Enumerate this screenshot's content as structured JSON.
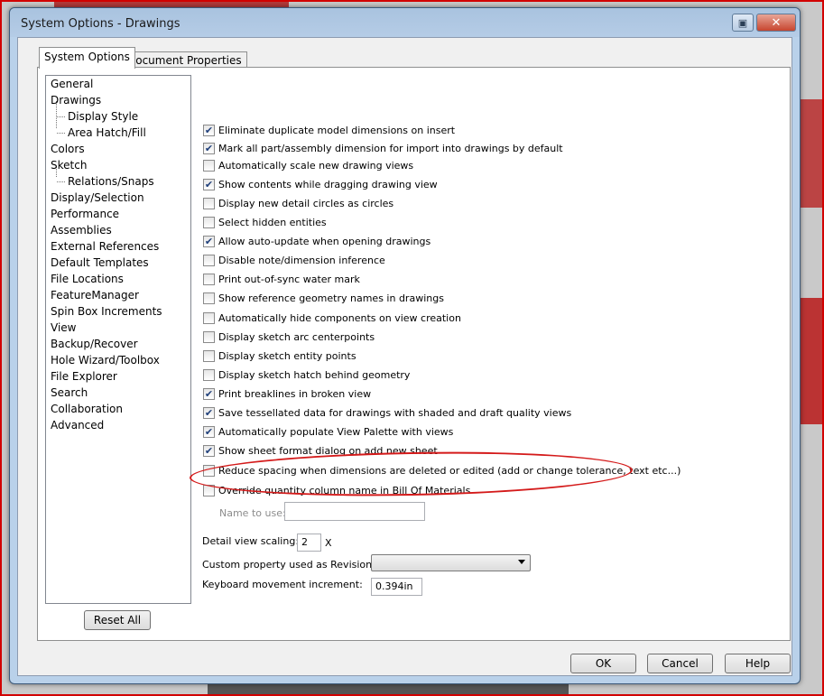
{
  "window": {
    "title": "System Options - Drawings"
  },
  "tabs": [
    {
      "label": "System Options",
      "active": true
    },
    {
      "label": "Document Properties",
      "active": false
    }
  ],
  "tree": [
    {
      "label": "General",
      "level": 0
    },
    {
      "label": "Drawings",
      "level": 0
    },
    {
      "label": "Display Style",
      "level": 1
    },
    {
      "label": "Area Hatch/Fill",
      "level": 1
    },
    {
      "label": "Colors",
      "level": 0
    },
    {
      "label": "Sketch",
      "level": 0
    },
    {
      "label": "Relations/Snaps",
      "level": 1
    },
    {
      "label": "Display/Selection",
      "level": 0
    },
    {
      "label": "Performance",
      "level": 0
    },
    {
      "label": "Assemblies",
      "level": 0
    },
    {
      "label": "External References",
      "level": 0
    },
    {
      "label": "Default Templates",
      "level": 0
    },
    {
      "label": "File Locations",
      "level": 0
    },
    {
      "label": "FeatureManager",
      "level": 0
    },
    {
      "label": "Spin Box Increments",
      "level": 0
    },
    {
      "label": "View",
      "level": 0
    },
    {
      "label": "Backup/Recover",
      "level": 0
    },
    {
      "label": "Hole Wizard/Toolbox",
      "level": 0
    },
    {
      "label": "File Explorer",
      "level": 0
    },
    {
      "label": "Search",
      "level": 0
    },
    {
      "label": "Collaboration",
      "level": 0
    },
    {
      "label": "Advanced",
      "level": 0
    }
  ],
  "reset_all_label": "Reset All",
  "options": [
    {
      "label": "Eliminate duplicate model dimensions on insert",
      "checked": true
    },
    {
      "label": "Mark all part/assembly dimension for import into drawings by default",
      "checked": true
    },
    {
      "label": "Automatically scale new drawing views",
      "checked": false
    },
    {
      "label": "Show contents while dragging drawing view",
      "checked": true
    },
    {
      "label": "Display new detail circles as circles",
      "checked": false
    },
    {
      "label": "Select hidden entities",
      "checked": false
    },
    {
      "label": "Allow auto-update when opening drawings",
      "checked": true
    },
    {
      "label": "Disable note/dimension inference",
      "checked": false
    },
    {
      "label": "Print out-of-sync water mark",
      "checked": false
    },
    {
      "label": "Show reference geometry names in drawings",
      "checked": false
    },
    {
      "label": "Automatically hide components on view creation",
      "checked": false
    },
    {
      "label": "Display sketch arc centerpoints",
      "checked": false
    },
    {
      "label": "Display sketch entity points",
      "checked": false
    },
    {
      "label": "Display sketch hatch behind geometry",
      "checked": false
    },
    {
      "label": "Print breaklines in broken view",
      "checked": true
    },
    {
      "label": "Save tessellated data for drawings with shaded and draft quality views",
      "checked": true
    },
    {
      "label": "Automatically populate View Palette with views",
      "checked": true
    },
    {
      "label": "Show sheet format dialog on add new sheet",
      "checked": true
    },
    {
      "label": "Reduce spacing when dimensions are deleted or edited (add or change tolerance, text etc...)",
      "checked": false
    },
    {
      "label": "Override quantity column name in Bill Of Materials",
      "checked": false
    }
  ],
  "name_to_use": {
    "label": "Name to use:",
    "value": ""
  },
  "detail_view_scaling": {
    "label": "Detail view scaling:",
    "value": "2",
    "suffix": "X"
  },
  "custom_property_revision": {
    "label": "Custom property used as Revision:",
    "value": ""
  },
  "keyboard_increment": {
    "label": "Keyboard movement increment:",
    "value": "0.394in"
  },
  "buttons": {
    "ok": "OK",
    "cancel": "Cancel",
    "help": "Help"
  },
  "colors": {
    "highlight": "#d41a1a",
    "check": "#1f3f7a"
  }
}
